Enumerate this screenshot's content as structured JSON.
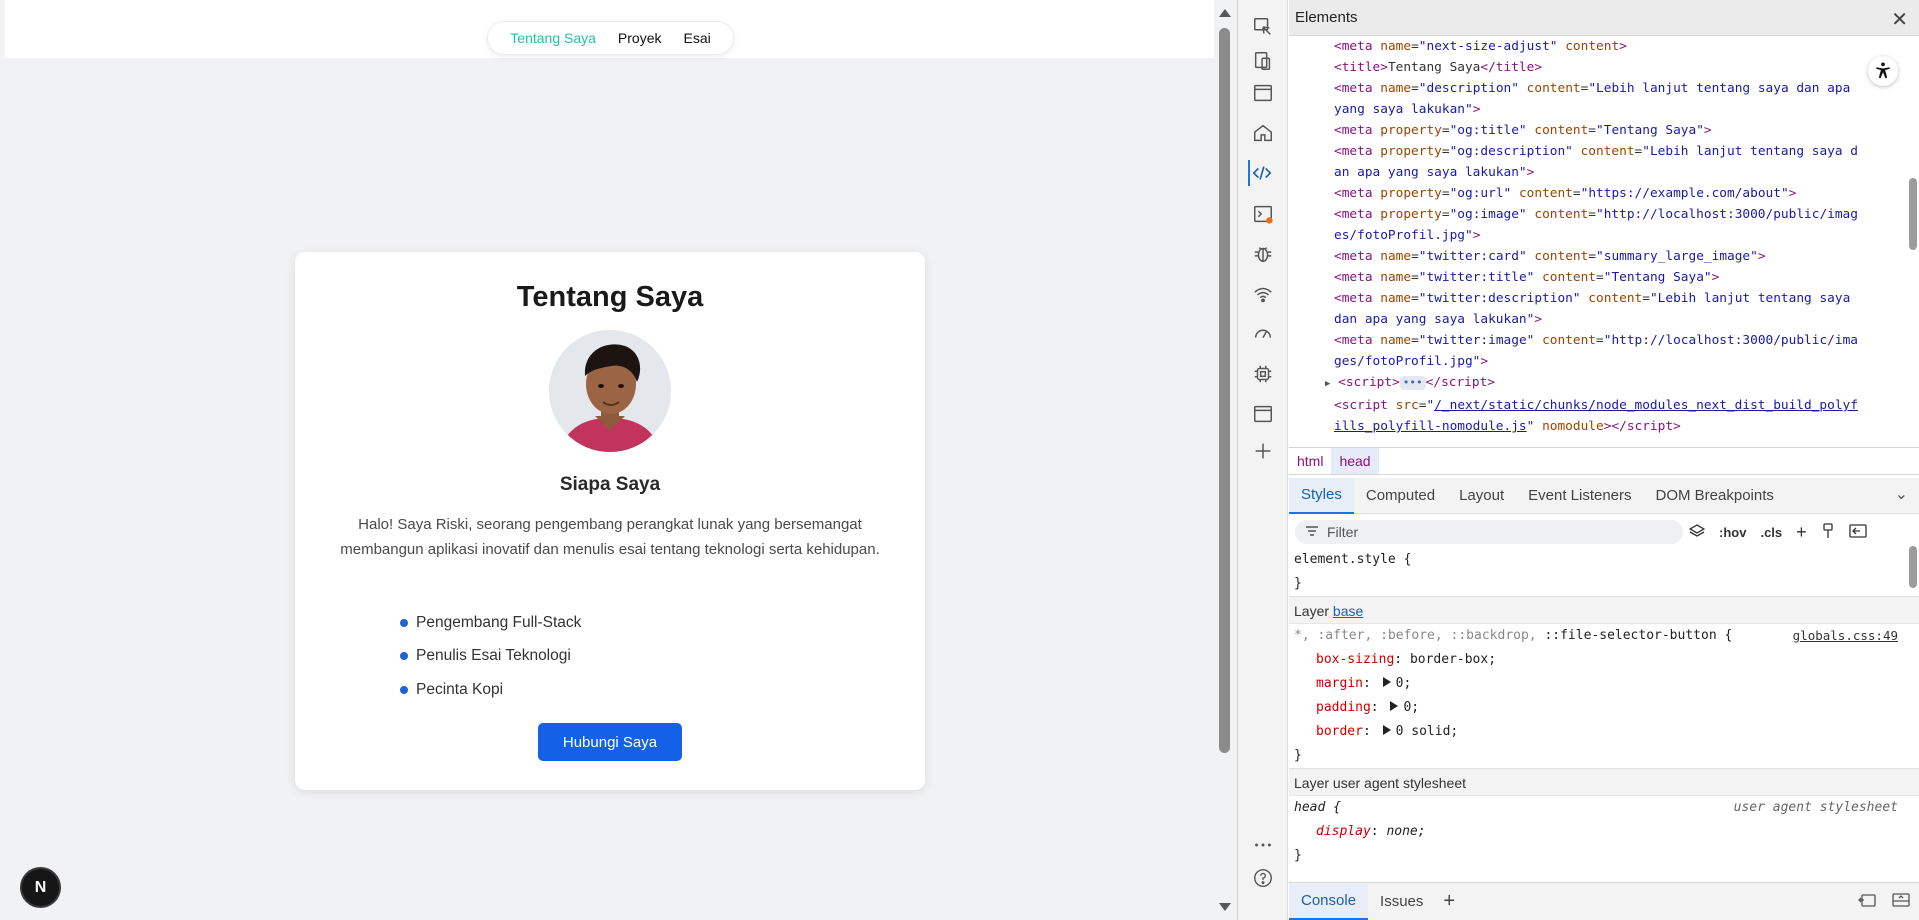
{
  "page": {
    "nav": {
      "items": [
        "Tentang Saya",
        "Proyek",
        "Esai"
      ],
      "active_index": 0,
      "active_color": "#1ec3a8"
    },
    "card": {
      "title": "Tentang Saya",
      "subtitle": "Siapa Saya",
      "description": "Halo! Saya Riski, seorang pengembang perangkat lunak yang bersemangat membangun aplikasi inovatif dan menulis esai tentang teknologi serta kehidupan.",
      "roles": [
        "Pengembang Full-Stack",
        "Penulis Esai Teknologi",
        "Pecinta Kopi"
      ],
      "cta_label": "Hubungi Saya",
      "cta_color": "#1461e8"
    },
    "next_badge": "N"
  },
  "devtools": {
    "panel_title": "Elements",
    "dom": {
      "title_tag_text": "Tentang Saya",
      "meta_next_size_adjust": "next-size-adjust",
      "meta_description": "Lebih lanjut tentang saya dan apa yang saya lakukan",
      "og_title": "Tentang Saya",
      "og_description": "Lebih lanjut tentang saya dan apa yang saya lakukan",
      "og_url": "https://example.com/about",
      "og_image": "http://localhost:3000/public/images/fotoProfil.jpg",
      "twitter_card": "summary_large_image",
      "twitter_title": "Tentang Saya",
      "twitter_description": "Lebih lanjut tentang saya dan apa yang saya lakukan",
      "twitter_image": "http://localhost:3000/public/images/fotoProfil.jpg",
      "script_src": "/_next/static/chunks/node_modules_next_dist_build_polyfills_polyfill-nomodule.js"
    },
    "breadcrumbs": [
      "html",
      "head"
    ],
    "styles_tabs": [
      "Styles",
      "Computed",
      "Layout",
      "Event Listeners",
      "DOM Breakpoints"
    ],
    "filter_placeholder": "Filter",
    "filter_tools": [
      ":hov",
      ".cls"
    ],
    "styles": {
      "element_style": "element.style {",
      "layer_label": "Layer",
      "layer_base": "base",
      "universal_selector": "*, :after, :before, ::backdrop, ::file-selector-button {",
      "universal_source": "globals.css:49",
      "props": [
        {
          "name": "box-sizing",
          "value": "border-box;",
          "expandable": false
        },
        {
          "name": "margin",
          "value": "0;",
          "expandable": true
        },
        {
          "name": "padding",
          "value": "0;",
          "expandable": true
        },
        {
          "name": "border",
          "value": "0 solid;",
          "expandable": true
        }
      ],
      "ua_layer": "Layer user agent stylesheet",
      "head_selector": "head {",
      "ua_note": "user agent stylesheet",
      "ua_prop_name": "display",
      "ua_prop_value": "none;"
    },
    "drawer_tabs": [
      "Console",
      "Issues"
    ]
  }
}
